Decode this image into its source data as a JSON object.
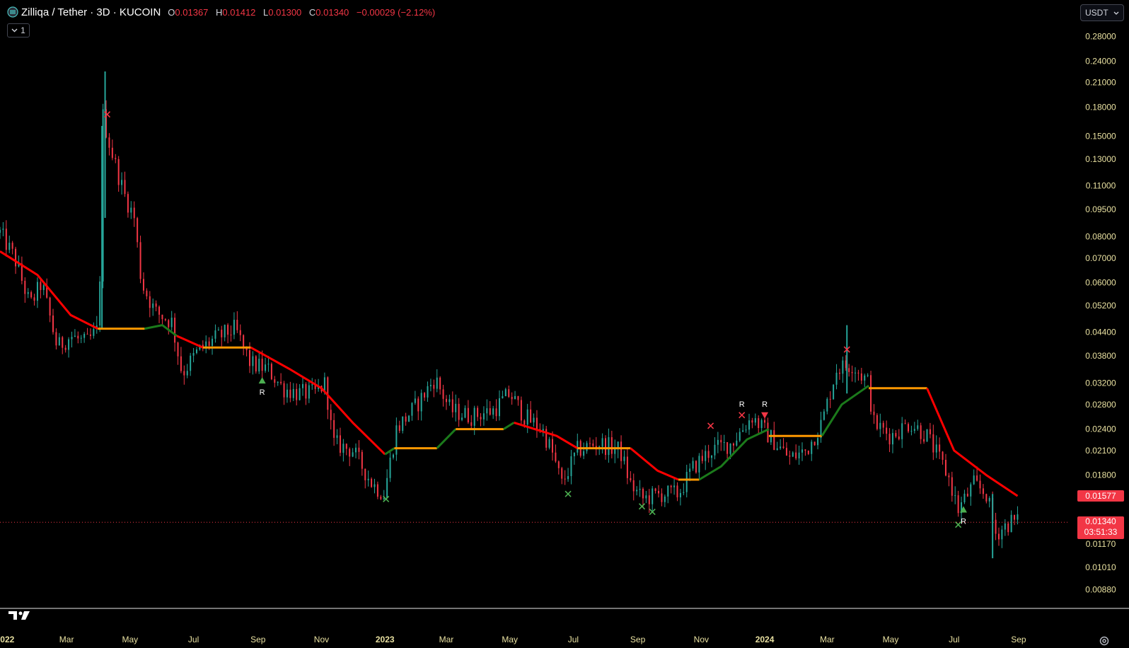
{
  "header": {
    "symbol_title": "Zilliqa / Tether · 3D · KUCOIN",
    "open_label": "O",
    "open_value": "0.01367",
    "high_label": "H",
    "high_value": "0.01412",
    "low_label": "L",
    "low_value": "0.01300",
    "close_label": "C",
    "close_value": "0.01340",
    "change": "−0.00029 (−2.12%)",
    "collapse_count": "1"
  },
  "currency": {
    "label": "USDT"
  },
  "price_tags": {
    "indicator_value": "0.01577",
    "last_price": "0.01340",
    "countdown": "03:51:33"
  },
  "colors": {
    "up": "#26a69a",
    "down": "#f23645",
    "trail_down": "#ff0000",
    "trail_up": "#1b7a1b",
    "trail_flat": "#ff9800",
    "axis_text": "#e8e0a0",
    "bg": "#000000",
    "signal_buy": "#4caf50",
    "signal_sell": "#f23645"
  },
  "icons": [
    "coin-icon",
    "chevron-down-icon",
    "tradingview-logo-icon",
    "settings-gear-icon"
  ],
  "chart_data": {
    "type": "candlestick",
    "scale": "log",
    "ylim": [
      0.0081,
      0.3
    ],
    "y_ticks": [
      0.28,
      0.24,
      0.21,
      0.18,
      0.15,
      0.13,
      0.11,
      0.095,
      0.08,
      0.07,
      0.06,
      0.052,
      0.044,
      0.038,
      0.032,
      0.028,
      0.024,
      0.021,
      0.018,
      0.0117,
      0.0101,
      0.0088
    ],
    "y_tick_labels": [
      "0.28000",
      "0.24000",
      "0.21000",
      "0.18000",
      "0.15000",
      "0.13000",
      "0.11000",
      "0.09500",
      "0.08000",
      "0.07000",
      "0.06000",
      "0.05200",
      "0.04400",
      "0.03800",
      "0.03200",
      "0.02800",
      "0.02400",
      "0.02100",
      "0.01800",
      "0.01170",
      "0.01010",
      "0.00880"
    ],
    "x_ticks": [
      {
        "label": "022",
        "date": "2022-01-03",
        "bold": true
      },
      {
        "label": "Mar",
        "date": "2022-03-01"
      },
      {
        "label": "May",
        "date": "2022-05-01"
      },
      {
        "label": "Jul",
        "date": "2022-07-01"
      },
      {
        "label": "Sep",
        "date": "2022-09-01"
      },
      {
        "label": "Nov",
        "date": "2022-11-01"
      },
      {
        "label": "2023",
        "date": "2023-01-01",
        "bold": true
      },
      {
        "label": "Mar",
        "date": "2023-03-01"
      },
      {
        "label": "May",
        "date": "2023-05-01"
      },
      {
        "label": "Jul",
        "date": "2023-07-01"
      },
      {
        "label": "Sep",
        "date": "2023-09-01"
      },
      {
        "label": "Nov",
        "date": "2023-11-01"
      },
      {
        "label": "2024",
        "date": "2024-01-01",
        "bold": true
      },
      {
        "label": "Mar",
        "date": "2024-03-01"
      },
      {
        "label": "May",
        "date": "2024-05-01"
      },
      {
        "label": "Jul",
        "date": "2024-07-01"
      },
      {
        "label": "Sep",
        "date": "2024-09-01"
      }
    ],
    "xlim": [
      "2021-12-27",
      "2024-10-20"
    ],
    "last_bar_date": "2024-08-31",
    "close_path": [
      [
        "2021-12-27",
        0.082
      ],
      [
        "2022-01-10",
        0.07
      ],
      [
        "2022-01-25",
        0.052
      ],
      [
        "2022-02-05",
        0.06
      ],
      [
        "2022-02-20",
        0.04
      ],
      [
        "2022-03-05",
        0.043
      ],
      [
        "2022-03-20",
        0.041
      ],
      [
        "2022-04-01",
        0.045
      ],
      [
        "2022-04-05",
        0.17
      ],
      [
        "2022-04-12",
        0.14
      ],
      [
        "2022-04-25",
        0.105
      ],
      [
        "2022-05-05",
        0.09
      ],
      [
        "2022-05-12",
        0.06
      ],
      [
        "2022-05-25",
        0.05
      ],
      [
        "2022-06-10",
        0.047
      ],
      [
        "2022-06-20",
        0.034
      ],
      [
        "2022-07-05",
        0.039
      ],
      [
        "2022-07-20",
        0.042
      ],
      [
        "2022-08-10",
        0.045
      ],
      [
        "2022-08-25",
        0.036
      ],
      [
        "2022-09-10",
        0.035
      ],
      [
        "2022-09-25",
        0.031
      ],
      [
        "2022-10-10",
        0.03
      ],
      [
        "2022-10-25",
        0.03
      ],
      [
        "2022-11-05",
        0.032
      ],
      [
        "2022-11-12",
        0.022
      ],
      [
        "2022-12-01",
        0.021
      ],
      [
        "2022-12-20",
        0.017
      ],
      [
        "2022-12-31",
        0.016
      ],
      [
        "2023-01-12",
        0.024
      ],
      [
        "2023-02-01",
        0.028
      ],
      [
        "2023-02-18",
        0.033
      ],
      [
        "2023-03-05",
        0.027
      ],
      [
        "2023-03-25",
        0.026
      ],
      [
        "2023-04-15",
        0.027
      ],
      [
        "2023-05-01",
        0.03
      ],
      [
        "2023-05-15",
        0.026
      ],
      [
        "2023-06-01",
        0.024
      ],
      [
        "2023-06-10",
        0.021
      ],
      [
        "2023-06-20",
        0.017
      ],
      [
        "2023-07-05",
        0.021
      ],
      [
        "2023-07-25",
        0.022
      ],
      [
        "2023-08-15",
        0.021
      ],
      [
        "2023-08-25",
        0.017
      ],
      [
        "2023-09-05",
        0.0155
      ],
      [
        "2023-09-25",
        0.016
      ],
      [
        "2023-10-10",
        0.016
      ],
      [
        "2023-10-25",
        0.019
      ],
      [
        "2023-11-10",
        0.021
      ],
      [
        "2023-11-30",
        0.022
      ],
      [
        "2023-12-20",
        0.026
      ],
      [
        "2024-01-05",
        0.023
      ],
      [
        "2024-01-25",
        0.02
      ],
      [
        "2024-02-10",
        0.021
      ],
      [
        "2024-02-25",
        0.025
      ],
      [
        "2024-03-10",
        0.035
      ],
      [
        "2024-03-25",
        0.036
      ],
      [
        "2024-04-10",
        0.032
      ],
      [
        "2024-04-14",
        0.025
      ],
      [
        "2024-05-01",
        0.023
      ],
      [
        "2024-05-20",
        0.025
      ],
      [
        "2024-06-05",
        0.023
      ],
      [
        "2024-06-25",
        0.018
      ],
      [
        "2024-07-05",
        0.0145
      ],
      [
        "2024-07-20",
        0.017
      ],
      [
        "2024-08-01",
        0.016
      ],
      [
        "2024-08-10",
        0.0125
      ],
      [
        "2024-08-25",
        0.0135
      ],
      [
        "2024-08-31",
        0.0134
      ]
    ],
    "spikes": [
      {
        "date": "2022-04-07",
        "high": 0.225,
        "low": 0.09
      },
      {
        "date": "2022-04-04",
        "high": 0.16,
        "low": 0.045
      },
      {
        "date": "2024-03-20",
        "high": 0.046,
        "low": 0.03
      },
      {
        "date": "2024-08-07",
        "high": 0.016,
        "low": 0.0107
      }
    ],
    "trailing_stop": [
      {
        "state": "down",
        "points": [
          [
            "2021-12-27",
            0.073
          ],
          [
            "2022-02-01",
            0.063
          ],
          [
            "2022-03-05",
            0.049
          ],
          [
            "2022-03-31",
            0.045
          ]
        ]
      },
      {
        "state": "flat",
        "points": [
          [
            "2022-03-31",
            0.045
          ],
          [
            "2022-05-15",
            0.045
          ]
        ]
      },
      {
        "state": "up",
        "points": [
          [
            "2022-05-15",
            0.045
          ],
          [
            "2022-06-01",
            0.046
          ],
          [
            "2022-06-15",
            0.043
          ]
        ]
      },
      {
        "state": "down",
        "points": [
          [
            "2022-06-15",
            0.043
          ],
          [
            "2022-07-10",
            0.04
          ]
        ]
      },
      {
        "state": "flat",
        "points": [
          [
            "2022-07-10",
            0.04
          ],
          [
            "2022-08-25",
            0.04
          ]
        ]
      },
      {
        "state": "down",
        "points": [
          [
            "2022-08-25",
            0.04
          ],
          [
            "2022-10-01",
            0.035
          ],
          [
            "2022-11-01",
            0.031
          ],
          [
            "2022-12-01",
            0.025
          ],
          [
            "2023-01-01",
            0.0205
          ]
        ]
      },
      {
        "state": "up",
        "points": [
          [
            "2023-01-01",
            0.0205
          ],
          [
            "2023-01-10",
            0.0213
          ]
        ]
      },
      {
        "state": "flat",
        "points": [
          [
            "2023-01-10",
            0.0213
          ],
          [
            "2023-02-20",
            0.0213
          ]
        ]
      },
      {
        "state": "up",
        "points": [
          [
            "2023-02-20",
            0.0213
          ],
          [
            "2023-03-10",
            0.024
          ]
        ]
      },
      {
        "state": "flat",
        "points": [
          [
            "2023-03-10",
            0.024
          ],
          [
            "2023-04-25",
            0.024
          ]
        ]
      },
      {
        "state": "up",
        "points": [
          [
            "2023-04-25",
            0.024
          ],
          [
            "2023-05-05",
            0.025
          ]
        ]
      },
      {
        "state": "down",
        "points": [
          [
            "2023-05-05",
            0.025
          ],
          [
            "2023-06-15",
            0.023
          ],
          [
            "2023-07-05",
            0.0213
          ]
        ]
      },
      {
        "state": "flat",
        "points": [
          [
            "2023-07-05",
            0.0213
          ],
          [
            "2023-08-25",
            0.0213
          ]
        ]
      },
      {
        "state": "down",
        "points": [
          [
            "2023-08-25",
            0.0213
          ],
          [
            "2023-09-20",
            0.0185
          ],
          [
            "2023-10-10",
            0.0175
          ]
        ]
      },
      {
        "state": "flat",
        "points": [
          [
            "2023-10-10",
            0.0175
          ],
          [
            "2023-10-30",
            0.0175
          ]
        ]
      },
      {
        "state": "up",
        "points": [
          [
            "2023-10-30",
            0.0175
          ],
          [
            "2023-11-20",
            0.019
          ],
          [
            "2023-12-15",
            0.0225
          ],
          [
            "2024-01-05",
            0.024
          ]
        ]
      },
      {
        "state": "flat",
        "points": [
          [
            "2024-01-05",
            0.023
          ],
          [
            "2024-02-25",
            0.023
          ]
        ]
      },
      {
        "state": "up",
        "points": [
          [
            "2024-02-25",
            0.023
          ],
          [
            "2024-03-15",
            0.028
          ],
          [
            "2024-04-10",
            0.0315
          ]
        ]
      },
      {
        "state": "flat",
        "points": [
          [
            "2024-04-10",
            0.031
          ],
          [
            "2024-06-05",
            0.031
          ]
        ]
      },
      {
        "state": "down",
        "points": [
          [
            "2024-06-05",
            0.031
          ],
          [
            "2024-07-01",
            0.021
          ],
          [
            "2024-08-01",
            0.018
          ],
          [
            "2024-08-31",
            0.0158
          ]
        ]
      }
    ],
    "markers": [
      {
        "type": "cross",
        "date": "2022-04-09",
        "price": 0.172,
        "color": "sell"
      },
      {
        "type": "triangle-up",
        "date": "2022-09-05",
        "price": 0.0325,
        "color": "buy",
        "label": "R"
      },
      {
        "type": "cross",
        "date": "2023-01-02",
        "price": 0.0155,
        "color": "buy"
      },
      {
        "type": "cross",
        "date": "2023-06-26",
        "price": 0.016,
        "color": "buy"
      },
      {
        "type": "cross",
        "date": "2023-09-05",
        "price": 0.0148,
        "color": "buy"
      },
      {
        "type": "cross",
        "date": "2023-09-15",
        "price": 0.0143,
        "color": "buy"
      },
      {
        "type": "cross",
        "date": "2023-11-10",
        "price": 0.0245,
        "color": "sell"
      },
      {
        "type": "cross",
        "date": "2023-12-10",
        "price": 0.0262,
        "color": "sell",
        "label": "R"
      },
      {
        "type": "triangle-down",
        "date": "2024-01-01",
        "price": 0.0262,
        "color": "sell",
        "label": "R"
      },
      {
        "type": "cross",
        "date": "2024-03-20",
        "price": 0.0395,
        "color": "sell"
      },
      {
        "type": "triangle-up",
        "date": "2024-07-10",
        "price": 0.0145,
        "color": "buy",
        "label": "R"
      },
      {
        "type": "cross",
        "date": "2024-07-05",
        "price": 0.0132,
        "color": "buy"
      }
    ]
  }
}
